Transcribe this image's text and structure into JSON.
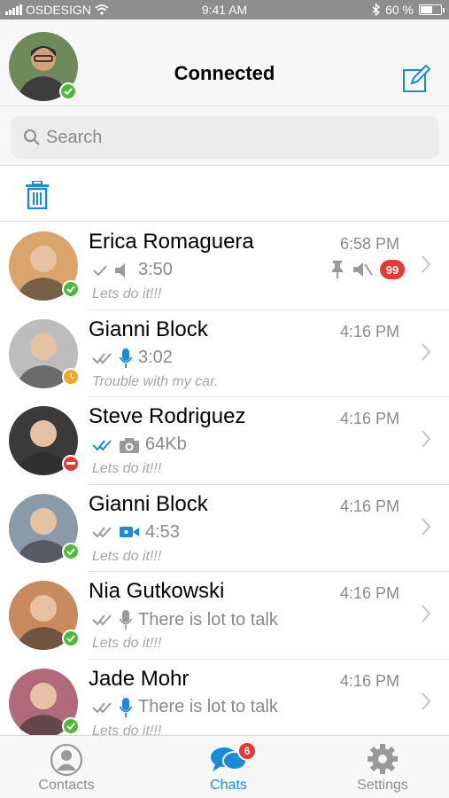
{
  "status_bar": {
    "carrier": "OSDESIGN",
    "time": "9:41 AM",
    "battery": "60 %",
    "battery_level": 0.6
  },
  "header": {
    "title": "Connected"
  },
  "search": {
    "placeholder": "Search"
  },
  "colors": {
    "accent": "#1a8bd8",
    "online": "#4cbb3a",
    "away": "#f5a623",
    "busy": "#e53935",
    "badge": "#e53935"
  },
  "chats": [
    {
      "name": "Erica Romaguera",
      "time": "6:58 PM",
      "status": "online",
      "ticks": "single",
      "media_icon": "speaker-icon",
      "detail": "3:50",
      "preview": "Lets do it!!!",
      "pinned": true,
      "muted": true,
      "unread": "99",
      "avatar_bg": "#d9a56a"
    },
    {
      "name": "Gianni Block",
      "time": "4:16 PM",
      "status": "away",
      "ticks": "double",
      "media_icon": "microphone-icon",
      "detail": "3:02",
      "preview": "Trouble with my car.",
      "avatar_bg": "#bdbdbd"
    },
    {
      "name": "Steve Rodriguez",
      "time": "4:16 PM",
      "status": "busy",
      "ticks": "double-read",
      "media_icon": "camera-icon",
      "detail": "64Kb",
      "preview": "Lets do it!!!",
      "avatar_bg": "#3a3a3a"
    },
    {
      "name": "Gianni Block",
      "time": "4:16 PM",
      "status": "online",
      "ticks": "double",
      "media_icon": "video-icon",
      "detail": "4:53",
      "preview": "Lets do it!!!",
      "avatar_bg": "#8a9aa8"
    },
    {
      "name": "Nia Gutkowski",
      "time": "4:16 PM",
      "status": "online",
      "ticks": "double",
      "media_icon": "microphone-icon",
      "detail": "There is lot to talk",
      "preview": "Lets do it!!!",
      "avatar_bg": "#c98a5e"
    },
    {
      "name": "Jade Mohr",
      "time": "4:16 PM",
      "status": "online",
      "ticks": "double",
      "media_icon": "microphone-icon",
      "detail": "There is lot to talk",
      "preview": "Lets do it!!!",
      "avatar_bg": "#b06a7a"
    }
  ],
  "tabs": [
    {
      "label": "Contacts",
      "icon": "contacts-icon",
      "active": false
    },
    {
      "label": "Chats",
      "icon": "chats-icon",
      "active": true,
      "badge": "6"
    },
    {
      "label": "Settings",
      "icon": "gear-icon",
      "active": false
    }
  ]
}
